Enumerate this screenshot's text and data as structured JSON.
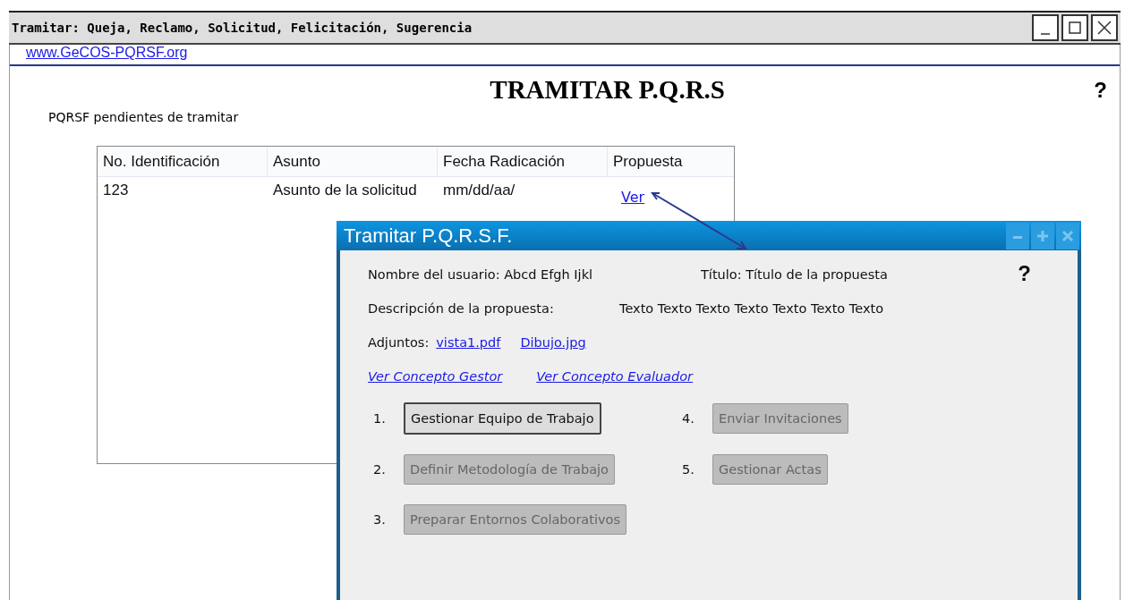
{
  "window": {
    "title": "Tramitar: Queja, Reclamo, Solicitud, Felicitación, Sugerencia"
  },
  "site_link": "www.GeCOS-PQRSF.org",
  "heading": "TRAMITAR P.Q.R.S",
  "help": "?",
  "section_label": "PQRSF pendientes de tramitar",
  "table": {
    "columns": [
      "No. Identificación",
      "Asunto",
      "Fecha Radicación",
      "Propuesta"
    ],
    "rows": [
      {
        "cells": [
          "123",
          "Asunto de la solicitud",
          "mm/dd/aa/"
        ],
        "link": "Ver"
      }
    ]
  },
  "dialog": {
    "title": "Tramitar P.Q.R.S.F.",
    "help": "?",
    "user": "Nombre del usuario: Abcd Efgh Ijkl",
    "proposal_title": "Título: Título de la propuesta",
    "description_label": "Descripción de la propuesta:",
    "description": "Texto Texto Texto Texto Texto Texto Texto",
    "attachments_label": "Adjuntos:",
    "attachments": [
      "vista1.pdf",
      "Dibujo.jpg"
    ],
    "concept_links": [
      "Ver Concepto Gestor",
      "Ver Concepto Evaluador"
    ],
    "steps": [
      {
        "number": "1.",
        "label": "Gestionar Equipo de Trabajo",
        "disabled": false
      },
      {
        "number": "2.",
        "label": "Definir Metodología de Trabajo",
        "disabled": true
      },
      {
        "number": "3.",
        "label": "Preparar Entornos Colaborativos",
        "disabled": true
      },
      {
        "number": "4.",
        "label": "Enviar Invitaciones",
        "disabled": true
      },
      {
        "number": "5.",
        "label": "Gestionar Actas",
        "disabled": true
      }
    ]
  }
}
